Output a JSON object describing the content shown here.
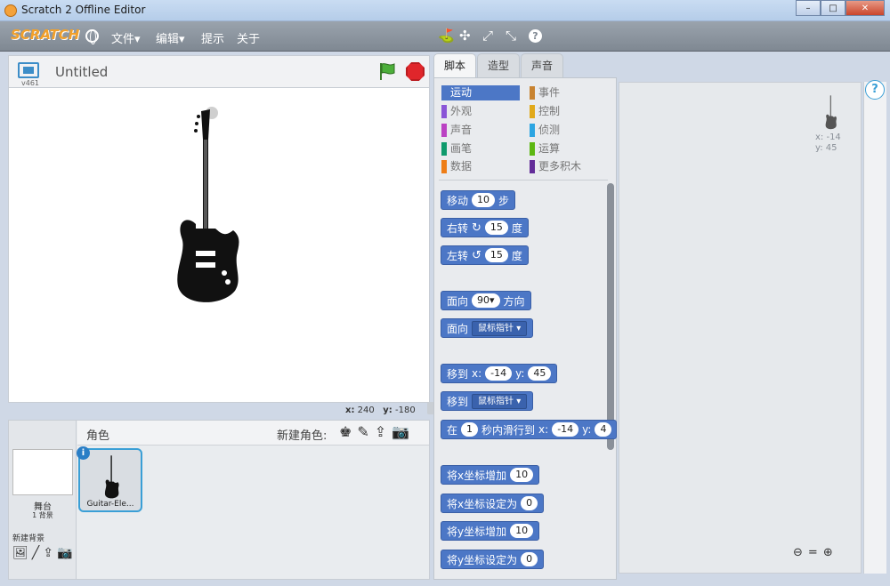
{
  "window": {
    "title": "Scratch 2 Offline Editor",
    "min": "–",
    "max": "□",
    "close": "✕"
  },
  "menubar": {
    "logo": "SCRATCH",
    "file": "文件▾",
    "edit": "编辑▾",
    "tips": "提示",
    "about": "关于"
  },
  "stage": {
    "title": "Untitled",
    "version": "v461",
    "mouse_x_label": "x:",
    "mouse_x": "240",
    "mouse_y_label": "y:",
    "mouse_y": "-180"
  },
  "tabs": [
    {
      "label": "脚本"
    },
    {
      "label": "造型"
    },
    {
      "label": "声音"
    }
  ],
  "categories": [
    {
      "label": "运动",
      "color": "#4c77c6"
    },
    {
      "label": "外观",
      "color": "#8a55d7"
    },
    {
      "label": "声音",
      "color": "#bb42c3"
    },
    {
      "label": "画笔",
      "color": "#0e9a6c"
    },
    {
      "label": "数据",
      "color": "#ee7d16"
    },
    {
      "label": "事件",
      "color": "#c88330"
    },
    {
      "label": "控制",
      "color": "#e1a91a"
    },
    {
      "label": "侦测",
      "color": "#2ca5e2"
    },
    {
      "label": "运算",
      "color": "#5cb712"
    },
    {
      "label": "更多积木",
      "color": "#632d99"
    }
  ],
  "blocks": {
    "move": {
      "pre": "移动",
      "val": "10",
      "post": "步"
    },
    "turn_right": {
      "pre": "右转",
      "icon": "↻",
      "val": "15",
      "post": "度"
    },
    "turn_left": {
      "pre": "左转",
      "icon": "↺",
      "val": "15",
      "post": "度"
    },
    "point_dir": {
      "pre": "面向",
      "val": "90▾",
      "post": "方向"
    },
    "point_towards": {
      "pre": "面向",
      "dd": "鼠标指针 ▾"
    },
    "goto_xy": {
      "pre": "移到",
      "x": "x:",
      "xv": "-14",
      "y": "y:",
      "yv": "45"
    },
    "goto": {
      "pre": "移到",
      "dd": "鼠标指针 ▾"
    },
    "glide": {
      "pre": "在",
      "v": "1",
      "mid": "秒内滑行到",
      "x": "x:",
      "xv": "-14",
      "y": "y:",
      "yv": "4"
    },
    "change_x": {
      "pre": "将x坐标增加",
      "val": "10"
    },
    "set_x": {
      "pre": "将x坐标设定为",
      "val": "0"
    },
    "change_y": {
      "pre": "将y坐标增加",
      "val": "10"
    },
    "set_y": {
      "pre": "将y坐标设定为",
      "val": "0"
    }
  },
  "sprites": {
    "header": "角色",
    "new_sprite": "新建角色:",
    "stage_label": "舞台",
    "stage_sub": "1 背景",
    "new_backdrop": "新建背景",
    "sprite_name": "Guitar-Ele..."
  },
  "script_area": {
    "x": "x: -14",
    "y": "y: 45"
  }
}
